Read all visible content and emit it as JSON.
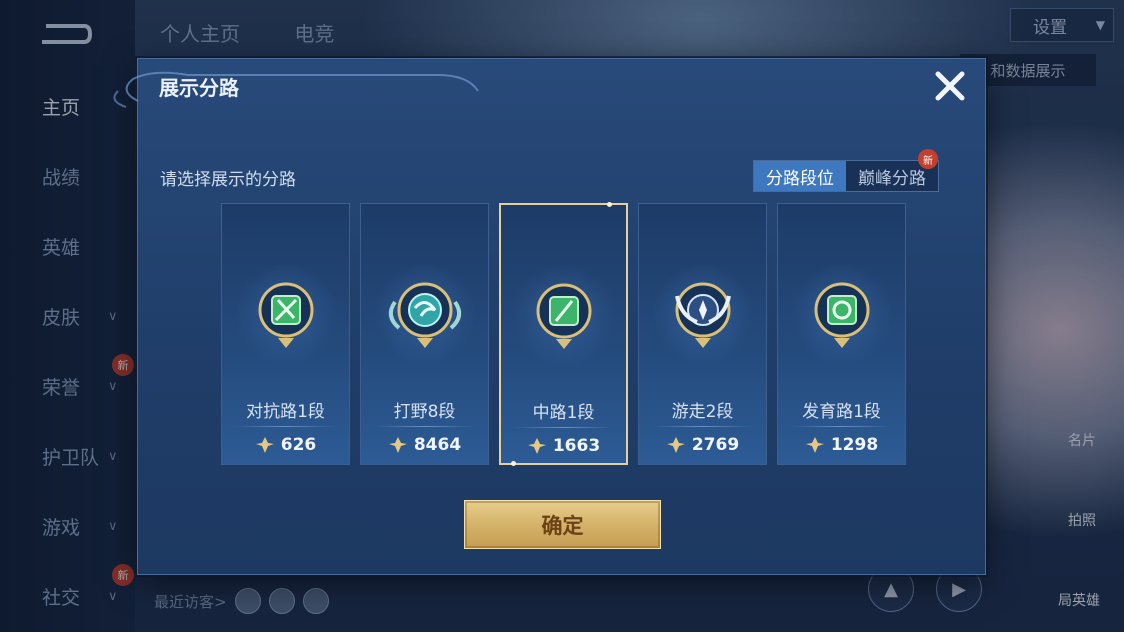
{
  "sidebar": {
    "items": [
      {
        "label": "主页",
        "active": true
      },
      {
        "label": "战绩"
      },
      {
        "label": "英雄"
      },
      {
        "label": "皮肤",
        "chevron": true
      },
      {
        "label": "荣誉",
        "chevron": true,
        "badge": "新"
      },
      {
        "label": "护卫队",
        "chevron": true
      },
      {
        "label": "游戏",
        "chevron": true
      },
      {
        "label": "社交",
        "chevron": true,
        "badge": "新"
      }
    ]
  },
  "top_tabs": [
    "个人主页",
    "电竞"
  ],
  "settings": {
    "label": "设置"
  },
  "data_show_label": "和数据展示",
  "visitors_label": "最近访客>",
  "right_side": {
    "label1": "名片",
    "label2": "拍照",
    "label3": "局英雄"
  },
  "modal": {
    "title": "展示分路",
    "prompt": "请选择展示的分路",
    "toggle": {
      "options": [
        "分路段位",
        "巅峰分路"
      ],
      "selected": "分路段位",
      "badge": "新"
    },
    "cards": [
      {
        "rank": "对抗路1段",
        "score": "626",
        "emblem": "sword-emblem-icon",
        "color": "#3cb46a"
      },
      {
        "rank": "打野8段",
        "score": "8464",
        "emblem": "dragon-emblem-icon",
        "color": "#2fa5a8"
      },
      {
        "rank": "中路1段",
        "score": "1663",
        "emblem": "mid-emblem-icon",
        "color": "#3cb46a",
        "selected": true
      },
      {
        "rank": "游走2段",
        "score": "2769",
        "emblem": "wings-emblem-icon",
        "color": "#7fa6d6"
      },
      {
        "rank": "发育路1段",
        "score": "1298",
        "emblem": "coin-emblem-icon",
        "color": "#3cb46a"
      }
    ],
    "confirm_label": "确定"
  },
  "colors": {
    "accent_blue": "#3e78bf",
    "gold": "#d6b56c",
    "badge_red": "#c4402e"
  }
}
